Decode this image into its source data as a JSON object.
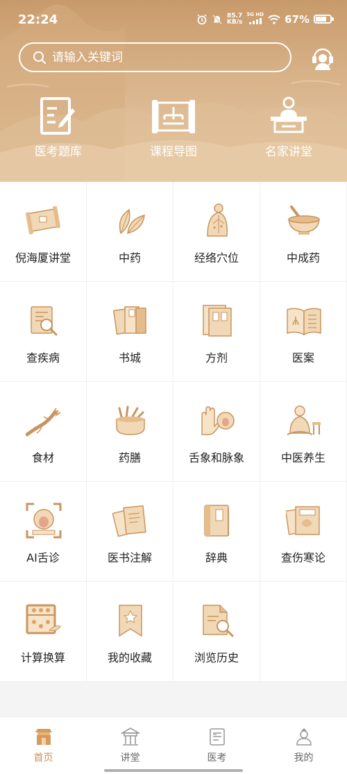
{
  "status": {
    "time": "22:24",
    "net_speed_value": "85.7",
    "net_speed_unit": "KB/s",
    "network": "5G HD",
    "battery": "67%",
    "battery_level": 0.67
  },
  "search": {
    "placeholder": "请输入关键词"
  },
  "quick_nav": [
    {
      "label": "医考题库",
      "icon": "exam-bank-icon"
    },
    {
      "label": "课程导图",
      "icon": "course-map-icon"
    },
    {
      "label": "名家讲堂",
      "icon": "lecture-hall-icon"
    }
  ],
  "grid": {
    "items": [
      {
        "label": "倪海厦讲堂",
        "icon": "scroll-icon"
      },
      {
        "label": "中药",
        "icon": "herb-leaf-icon"
      },
      {
        "label": "经络穴位",
        "icon": "meridian-body-icon"
      },
      {
        "label": "中成药",
        "icon": "mortar-icon"
      },
      {
        "label": "查疾病",
        "icon": "disease-search-icon"
      },
      {
        "label": "书城",
        "icon": "books-icon"
      },
      {
        "label": "方剂",
        "icon": "prescription-icon"
      },
      {
        "label": "医案",
        "icon": "case-book-icon"
      },
      {
        "label": "食材",
        "icon": "ginseng-icon"
      },
      {
        "label": "药膳",
        "icon": "medicinal-food-icon"
      },
      {
        "label": "舌象和脉象",
        "icon": "hand-tongue-icon"
      },
      {
        "label": "中医养生",
        "icon": "meditation-icon"
      },
      {
        "label": "AI舌诊",
        "icon": "ai-tongue-scan-icon"
      },
      {
        "label": "医书注解",
        "icon": "annotated-book-icon"
      },
      {
        "label": "辞典",
        "icon": "dictionary-icon"
      },
      {
        "label": "查伤寒论",
        "icon": "shanghan-book-icon"
      },
      {
        "label": "计算换算",
        "icon": "abacus-icon"
      },
      {
        "label": "我的收藏",
        "icon": "bookmark-star-icon"
      },
      {
        "label": "浏览历史",
        "icon": "history-icon"
      }
    ]
  },
  "tabs": [
    {
      "label": "首页",
      "icon": "home-pavilion-icon",
      "active": true
    },
    {
      "label": "讲堂",
      "icon": "temple-icon",
      "active": false
    },
    {
      "label": "医考",
      "icon": "exam-icon",
      "active": false
    },
    {
      "label": "我的",
      "icon": "profile-icon",
      "active": false
    }
  ],
  "colors": {
    "accent": "#c8915a",
    "header": "#d4a979",
    "icon_fill": "#f1d8b6",
    "icon_line": "#c8955f"
  }
}
